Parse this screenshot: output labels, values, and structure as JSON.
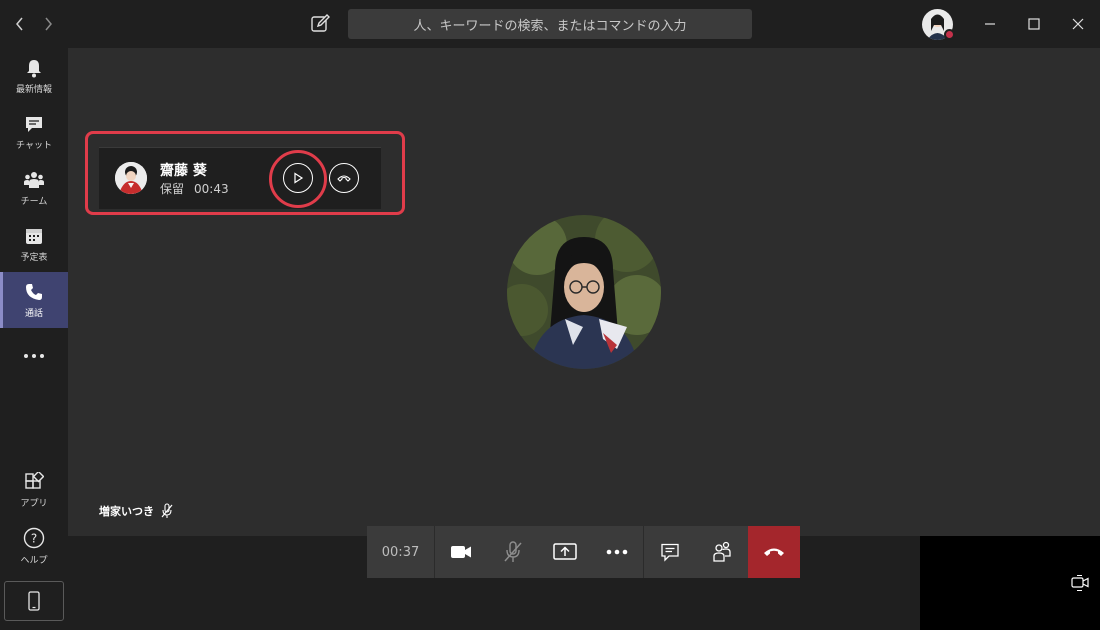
{
  "titlebar": {
    "search_placeholder": "人、キーワードの検索、またはコマンドの入力"
  },
  "rail": {
    "items": [
      {
        "label": "最新情報",
        "icon": "bell-icon"
      },
      {
        "label": "チャット",
        "icon": "chat-icon"
      },
      {
        "label": "チーム",
        "icon": "teams-icon"
      },
      {
        "label": "予定表",
        "icon": "calendar-icon"
      },
      {
        "label": "通話",
        "icon": "phone-icon",
        "active": true
      },
      {
        "label": "",
        "icon": "more-icon"
      },
      {
        "label": "アプリ",
        "icon": "apps-icon"
      },
      {
        "label": "ヘルプ",
        "icon": "help-icon"
      }
    ]
  },
  "held_call": {
    "name": "齋藤 葵",
    "status": "保留",
    "duration": "00:43"
  },
  "self": {
    "name": "増家いつき"
  },
  "call_controls": {
    "timer": "00:37"
  },
  "colors": {
    "accent": "#8b8cc7",
    "hangup": "#a4262c",
    "highlight": "#e03c4a",
    "presence_busy": "#c4314b"
  }
}
